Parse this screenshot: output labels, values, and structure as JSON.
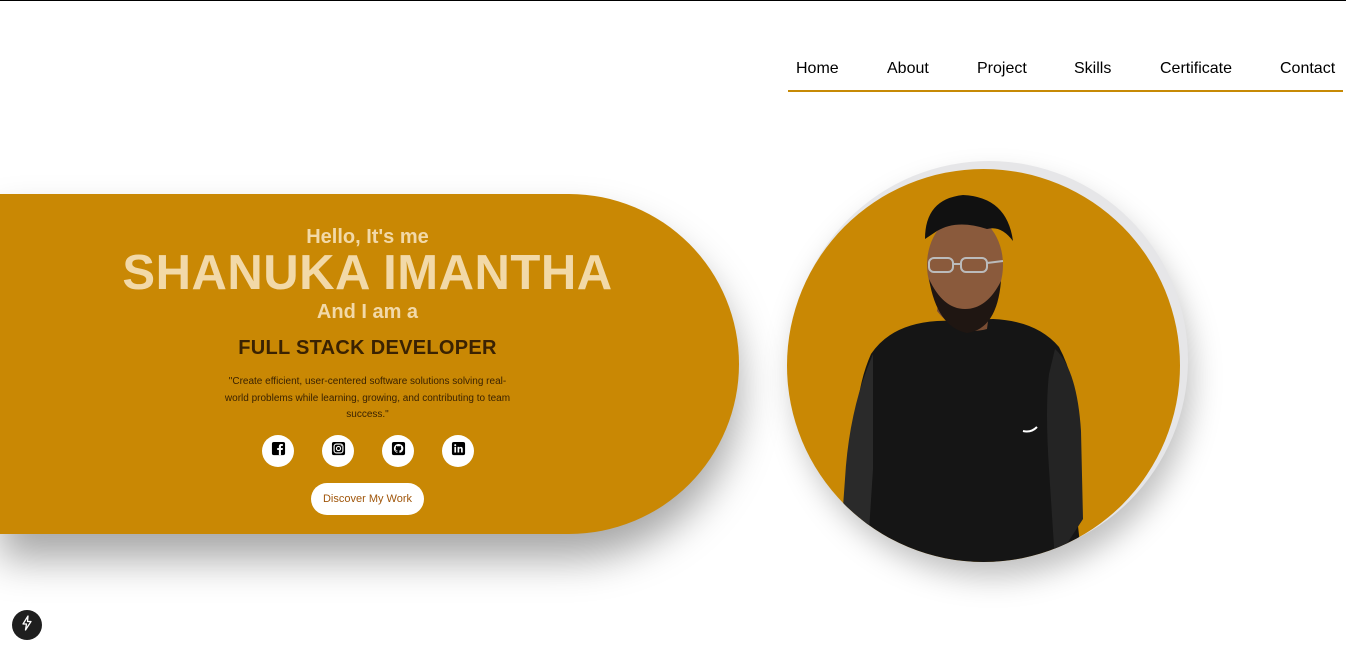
{
  "nav": {
    "items": [
      {
        "label": "Home"
      },
      {
        "label": "About"
      },
      {
        "label": "Project"
      },
      {
        "label": "Skills"
      },
      {
        "label": "Certificate"
      },
      {
        "label": "Contact"
      }
    ]
  },
  "hero": {
    "greeting": "Hello, It's me",
    "name": "SHANUKA IMANTHA",
    "intro": "And I am a",
    "role": "FULL STACK DEVELOPER",
    "quote": "\"Create efficient, user-centered software solutions solving real-world problems while learning, growing, and contributing to team success.\"",
    "social": [
      {
        "icon": "facebook-icon"
      },
      {
        "icon": "instagram-icon"
      },
      {
        "icon": "github-icon"
      },
      {
        "icon": "linkedin-icon"
      }
    ],
    "cta_label": "Discover My Work"
  },
  "colors": {
    "accent": "#c98804",
    "accent_text": "#f2d9a8",
    "dark_text": "#3a2202",
    "cta_text": "#a0560b"
  },
  "badge": {
    "icon": "lightning-icon"
  }
}
